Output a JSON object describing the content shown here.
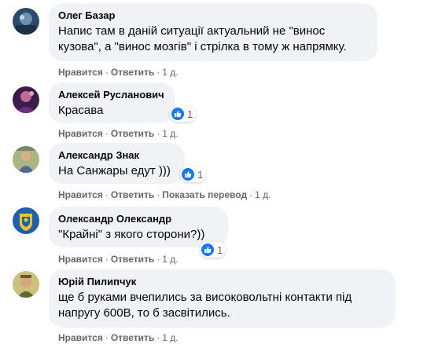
{
  "comments": [
    {
      "author": "Олег Базар",
      "text": "Напис там в даній ситуації актуальний не \"винос\nкузова\", а \"винос мозгів\" і стрілка в тому ж напрямку.",
      "like": "Нравится",
      "reply": "Ответить",
      "time": "1 д.",
      "avatar_color": "#2c4a6b"
    },
    {
      "author": "Алексей Русланович",
      "text": "Красава",
      "like": "Нравится",
      "reply": "Ответить",
      "time": "1 д.",
      "reaction_count": "1",
      "avatar_color": "#3a1d4a"
    },
    {
      "author": "Александр Знак",
      "text": "На Санжары едут )))",
      "like": "Нравится",
      "reply": "Ответить",
      "translate": "Показать перевод",
      "time": "1 д.",
      "reaction_count": "1",
      "avatar_color": "#8a9a6a"
    },
    {
      "author": "Олександр Олександр",
      "text": "\"Крайні\" з якого сторони?))",
      "like": "Нравится",
      "reply": "Ответить",
      "time": "1 д.",
      "reaction_count": "1",
      "avatar_color": "#1e5fb0"
    },
    {
      "author": "Юрій Пилипчук",
      "text": "ще б руками вчепились за високовольтні контакти під\nнапругу 600В, то б засвітились.",
      "like": "Нравится",
      "reply": "Ответить",
      "time": "1 д.",
      "avatar_color": "#b9b46a"
    }
  ],
  "colors": {
    "bubble": "#f0f2f5",
    "meta": "#65676b",
    "like_blue": "#1877f2"
  }
}
